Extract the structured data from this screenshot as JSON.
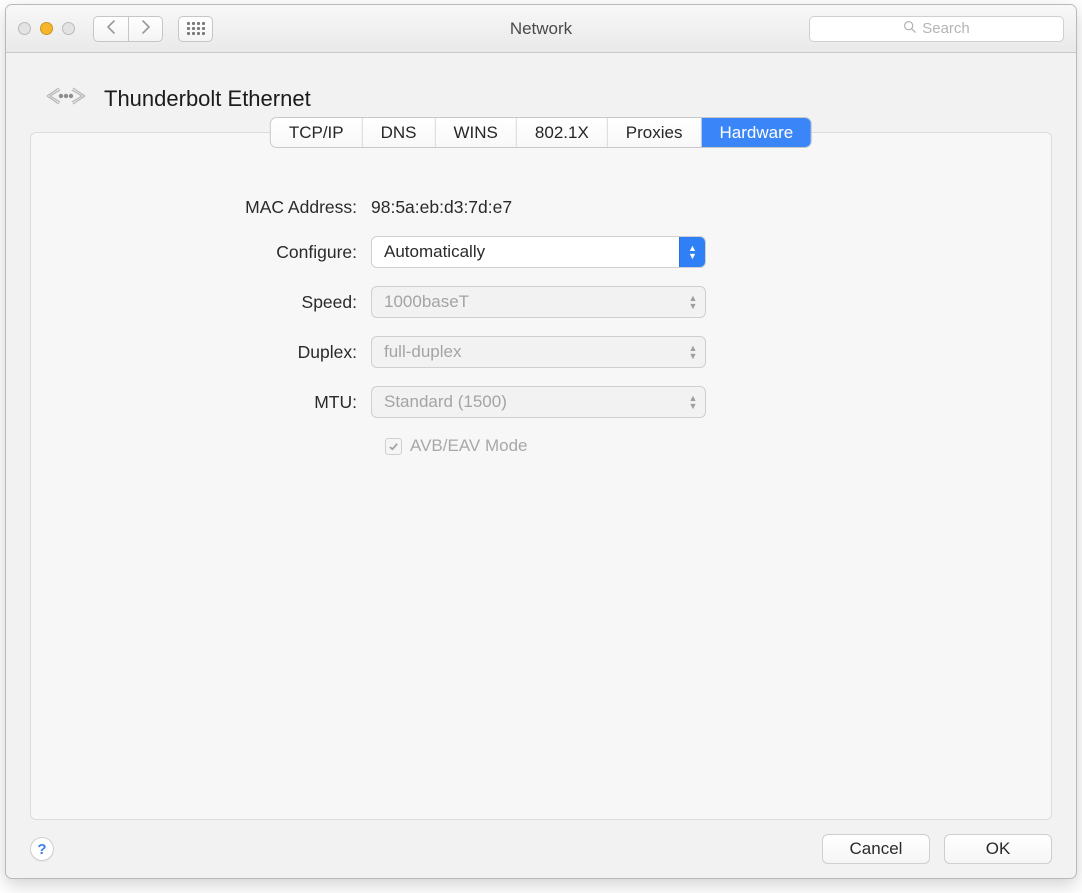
{
  "window": {
    "title": "Network",
    "search_placeholder": "Search"
  },
  "interface": {
    "name": "Thunderbolt Ethernet"
  },
  "tabs": {
    "items": [
      {
        "label": "TCP/IP"
      },
      {
        "label": "DNS"
      },
      {
        "label": "WINS"
      },
      {
        "label": "802.1X"
      },
      {
        "label": "Proxies"
      },
      {
        "label": "Hardware"
      }
    ],
    "active_index": 5
  },
  "hardware": {
    "mac_label": "MAC Address:",
    "mac_value": "98:5a:eb:d3:7d:e7",
    "configure_label": "Configure:",
    "configure_value": "Automatically",
    "speed_label": "Speed:",
    "speed_value": "1000baseT",
    "duplex_label": "Duplex:",
    "duplex_value": "full-duplex",
    "mtu_label": "MTU:",
    "mtu_value": "Standard  (1500)",
    "avb_label": "AVB/EAV Mode",
    "avb_checked": true
  },
  "footer": {
    "help_label": "?",
    "cancel_label": "Cancel",
    "ok_label": "OK"
  }
}
